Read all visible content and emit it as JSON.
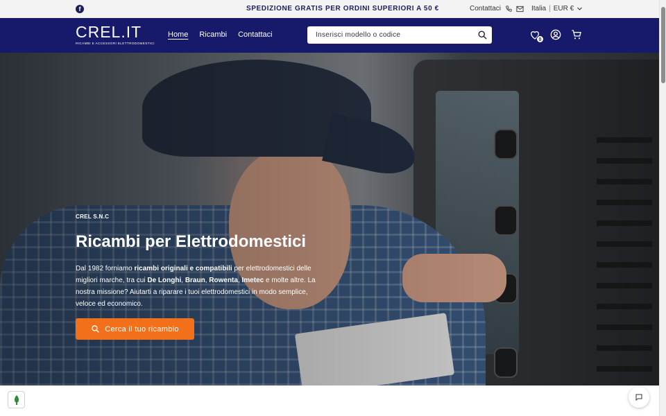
{
  "topbar": {
    "social_icon": "facebook-icon",
    "announcement": "SPEDIZIONE GRATIS PER ORDINI SUPERIORI A 50 €",
    "contact_label": "Contattaci",
    "country": "Italia",
    "separator": "|",
    "currency": "EUR €"
  },
  "header": {
    "logo_main": "CREL.IT",
    "logo_sub": "RICAMBI E ACCESSORI ELETTRODOMESTICI",
    "nav": [
      {
        "label": "Home"
      },
      {
        "label": "Ricambi"
      },
      {
        "label": "Contattaci"
      }
    ],
    "search_placeholder": "Inserisci modello o codice",
    "wishlist_count": "0"
  },
  "hero": {
    "eyebrow": "CREL S.N.C",
    "title": "Ricambi per Elettrodomestici",
    "text_1": "Dal 1982 forniamo ",
    "text_bold_1": "ricambi originali e compatibili",
    "text_2": " per elettrodomestici delle migliori marche, tra cui ",
    "text_bold_2": "De Longhi",
    "text_3": ", ",
    "text_bold_3": "Braun",
    "text_4": ", ",
    "text_bold_4": "Rowenta",
    "text_5": ", ",
    "text_bold_5": "Imetec",
    "text_6": " e molte altre. La nostra missione? Aiutarti a riparare i tuoi elettrodomestici in modo semplice, veloce ed economico.",
    "cta_label": "Cerca il tuo ricambio"
  },
  "colors": {
    "header_bg": "#17196a",
    "cta_bg": "#f2701a",
    "topbar_bg": "#f3f3f3"
  }
}
